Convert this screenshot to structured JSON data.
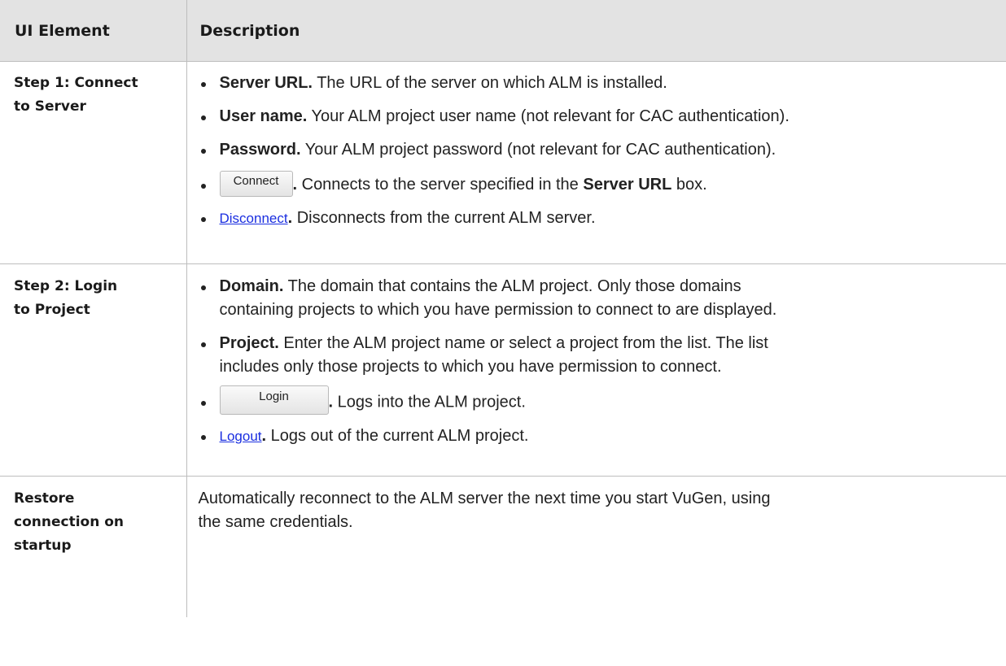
{
  "table": {
    "headers": [
      "UI Element",
      "Description"
    ],
    "rows": [
      {
        "element_lines": [
          "Step 1: Connect",
          "to Server"
        ],
        "items": [
          {
            "term": "Server URL.",
            "text": " The URL of the server on which ALM is installed."
          },
          {
            "term": "User name.",
            "text": " Your ALM project user name (not relevant for CAC authentication)."
          },
          {
            "term": "Password.",
            "text": " Your ALM project password (not relevant for CAC authentication)."
          },
          {
            "button": "Connect",
            "sep": ".",
            "text": " Connects to the server specified in the ",
            "strong": "Server URL",
            "tail": " box."
          },
          {
            "link": "Disconnect",
            "sep": ".",
            "text": " Disconnects from the current ALM server."
          }
        ]
      },
      {
        "element_lines": [
          "Step 2: Login",
          "to Project"
        ],
        "items": [
          {
            "term": "Domain.",
            "text": " The domain that contains the ALM project. Only those domains",
            "text2": "containing projects to which you have permission to connect to are displayed."
          },
          {
            "term": "Project.",
            "text": " Enter the ALM project name or select a project from the list. The list",
            "text2": "includes only those projects to which you have permission to connect."
          },
          {
            "button": "Login",
            "sep": ".",
            "text": " Logs into the ALM project."
          },
          {
            "link": "Logout",
            "sep": ".",
            "text": " Logs out of the current ALM project."
          }
        ]
      },
      {
        "element_lines": [
          "Restore",
          "connection on",
          "startup"
        ],
        "paragraph_lines": [
          "Automatically reconnect to the ALM server the next time you start VuGen, using",
          "the same credentials."
        ]
      }
    ]
  }
}
